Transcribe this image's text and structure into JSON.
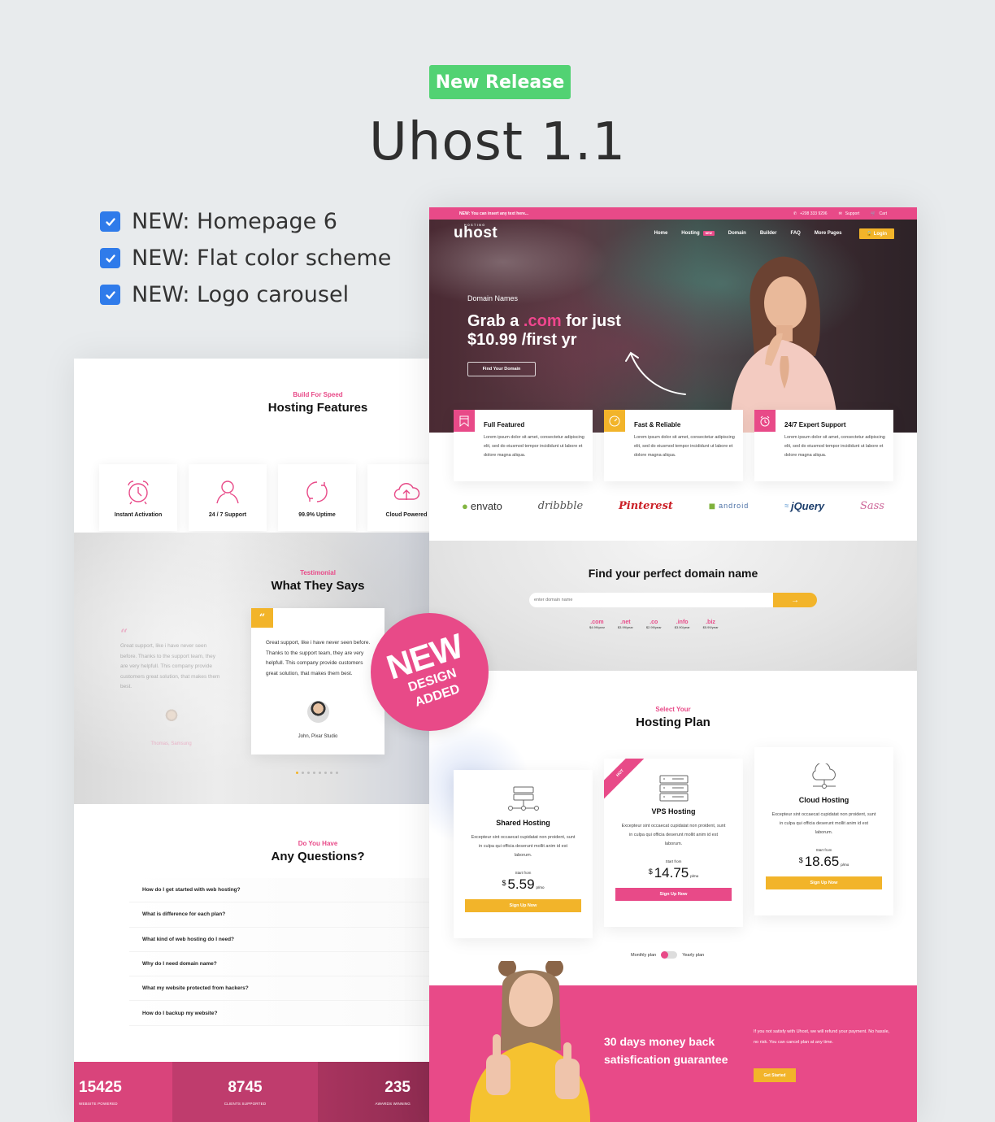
{
  "release_badge": "New Release",
  "title": "Uhost 1.1",
  "features": [
    "NEW: Homepage 6",
    "NEW: Flat color scheme",
    "NEW: Logo carousel"
  ],
  "new_badge": {
    "line1": "NEW",
    "line2": "DESIGN",
    "line3": "ADDED"
  },
  "colors": {
    "pink": "#e84a88",
    "yellow": "#f2b42a",
    "green": "#52d273",
    "blue": "#2f7bea"
  },
  "left_page": {
    "hosting_features": {
      "kicker": "Build For Speed",
      "title": "Hosting Features",
      "cards": [
        {
          "icon": "alarm-clock-icon",
          "label": "Instant Activation"
        },
        {
          "icon": "user-icon",
          "label": "24 / 7 Support"
        },
        {
          "icon": "refresh-icon",
          "label": "99.9% Uptime"
        },
        {
          "icon": "cloud-upload-icon",
          "label": "Cloud Powered"
        }
      ]
    },
    "testimonial": {
      "kicker": "Testimonial",
      "title": "What They Says",
      "faded": {
        "text": "Great support, like i have never seen before. Thanks to the support team, they are very helpfull. This company provide customers great solution, that makes them best.",
        "name": "Thomas, Samsung"
      },
      "active": {
        "text": "Great support, like i have never seen before. Thanks to the support team, they are very helpfull. This company provide customers great solution, that makes them best.",
        "name": "John, Pixar Studio"
      },
      "dots_count": 8,
      "active_dot": 0
    },
    "faq": {
      "kicker": "Do You Have",
      "title": "Any Questions?",
      "items": [
        "How do I get started with web hosting?",
        "What is difference for each plan?",
        "What kind of web hosting do I need?",
        "Why do I need domain name?",
        "What my website protected from hackers?",
        "How do I backup my website?"
      ]
    },
    "stats": [
      {
        "value": "15425",
        "label": "WEBSITE POWERED"
      },
      {
        "value": "8745",
        "label": "CLIENTS SUPPORTED"
      },
      {
        "value": "235",
        "label": "AWARDS WINNING"
      }
    ]
  },
  "right_page": {
    "topbar": {
      "notice": "NEW: You can insert any text here...",
      "phone": "+208 333 9296",
      "support": "Support",
      "cart": "Cart"
    },
    "nav": {
      "logo": "uhost",
      "logo_sub": "HOSTING",
      "links": [
        "Home",
        "Hosting",
        "Domain",
        "Builder",
        "FAQ",
        "More Pages"
      ],
      "hosting_badge": "NEW",
      "login": "Login"
    },
    "hero": {
      "kicker": "Domain Names",
      "title_a": "Grab a ",
      "title_highlight": ".com",
      "title_b": " for just",
      "title_line2": "$10.99 /first yr",
      "button": "Find Your Domain"
    },
    "hero_features": [
      {
        "icon": "bookmark-icon",
        "color": "#e84a88",
        "title": "Full Featured",
        "text": "Lorem ipsum dolor sit amet, consectetur adipiscing elit, sed do eiusmod tempor incididunt ut labore et dolore magna aliqua."
      },
      {
        "icon": "speedometer-icon",
        "color": "#f2b42a",
        "title": "Fast & Reliable",
        "text": "Lorem ipsum dolor sit amet, consectetur adipiscing elit, sed do eiusmod tempor incididunt ut labore et dolore magna aliqua."
      },
      {
        "icon": "alarm-clock-icon",
        "color": "#e84a88",
        "title": "24/7 Expert Support",
        "text": "Lorem ipsum dolor sit amet, consectetur adipiscing elit, sed do eiusmod tempor incididunt ut labore et dolore magna aliqua."
      }
    ],
    "brands": [
      "envato",
      "dribbble",
      "Pinterest",
      "android",
      "jQuery",
      "Sass"
    ],
    "domain": {
      "title": "Find your perfect domain name",
      "placeholder": "enter domain name",
      "tlds": [
        {
          "name": ".com",
          "price": "$4.99/year"
        },
        {
          "name": ".net",
          "price": "$3.99/year"
        },
        {
          "name": ".co",
          "price": "$2.99/year"
        },
        {
          "name": ".info",
          "price": "$3.90/year"
        },
        {
          "name": ".biz",
          "price": "$5.99/year"
        }
      ]
    },
    "plans": {
      "kicker": "Select Your",
      "title": "Hosting Plan",
      "items": [
        {
          "name": "Shared Hosting",
          "desc": "Excepteur sint occaecat cupidatat non proident, sunt in culpa qui officia deserunt mollit anim id est laborum.",
          "from": "Start from",
          "currency": "$",
          "price": "5.59",
          "per": "p/mo",
          "button": "Sign Up Now"
        },
        {
          "name": "VPS Hosting",
          "desc": "Excepteur sint occaecat cupidatat non proident, sunt in culpa qui officia deserunt mollit anim id est laborum.",
          "from": "Start from",
          "currency": "$",
          "price": "14.75",
          "per": "p/mo",
          "button": "Sign Up Now",
          "ribbon": "HOT"
        },
        {
          "name": "Cloud Hosting",
          "desc": "Excepteur sint occaecat cupidatat non proident, sunt in culpa qui officia deserunt mollit anim id est laborum.",
          "from": "Start from",
          "currency": "$",
          "price": "18.65",
          "per": "p/mo",
          "button": "Sign Up Now"
        }
      ],
      "toggle": {
        "left": "Monthly plan",
        "right": "Yearly plan",
        "state": "monthly"
      }
    },
    "guarantee": {
      "title_line1": "30 days money back",
      "title_line2": "satisfication guarantee",
      "text": "If you not satisfy with Uhost, we will refund your payment. No hassle, no risk. You can cancel plan at any time.",
      "button": "Get Started"
    }
  }
}
